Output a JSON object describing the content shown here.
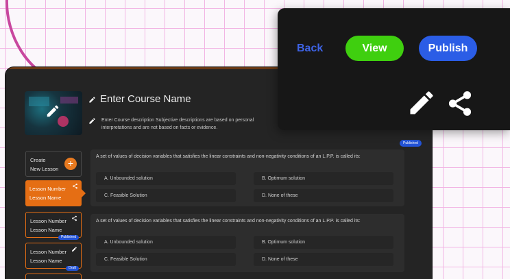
{
  "action_panel": {
    "back_label": "Back",
    "view_label": "View",
    "publish_label": "Publish"
  },
  "course": {
    "title": "Enter Course Name",
    "description": "Enter Course description Subjective descriptions are based on personal interpretations and are not based on facts or evidence.",
    "status_badge": "Published"
  },
  "sidebar": {
    "create_label_line1": "Create",
    "create_label_line2": "New Lesson",
    "lessons": [
      {
        "number": "Lesson Number",
        "name": "Lesson Name",
        "badge": ""
      },
      {
        "number": "Lesson Number",
        "name": "Lesson Name",
        "badge": "Published"
      },
      {
        "number": "Lesson Number",
        "name": "Lesson Name",
        "badge": "Draft"
      }
    ]
  },
  "questions": [
    {
      "text": "A set of values of decision variables that satisfies the linear constraints and non-negativity conditions of an L.P.P. is called its:",
      "options": [
        "A. Unbounded solution",
        "B. Optimum solution",
        "C. Feasible Solution",
        "D. None of these"
      ]
    },
    {
      "text": "A set of values of decision variables that satisfies the linear constraints and non-negativity conditions of an L.P.P. is called its:",
      "options": [
        "A. Unbounded solution",
        "B. Optimum solution",
        "C. Feasible Solution",
        "D. None of these"
      ]
    }
  ],
  "colors": {
    "accent_orange": "#e56e14",
    "view_green": "#3fcf0f",
    "publish_blue": "#2b5de6",
    "back_blue": "#3e63e6",
    "arrow_pink": "#c8479e"
  }
}
